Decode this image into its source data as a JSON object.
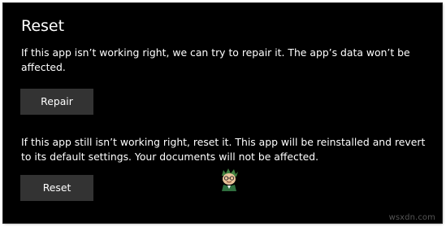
{
  "settings": {
    "title": "Reset",
    "repair_description": "If this app isn’t working right, we can try to repair it. The app’s data won’t be affected.",
    "repair_button_label": "Repair",
    "reset_description": "If this app still isn’t working right, reset it. This app will be reinstalled and revert to its default settings. Your documents will not be affected.",
    "reset_button_label": "Reset"
  },
  "watermark": {
    "logo_icon": "appuals-mascot-icon",
    "text": "wsxdn.com"
  },
  "colors": {
    "background": "#000000",
    "text": "#ffffff",
    "button_background": "#333333"
  }
}
